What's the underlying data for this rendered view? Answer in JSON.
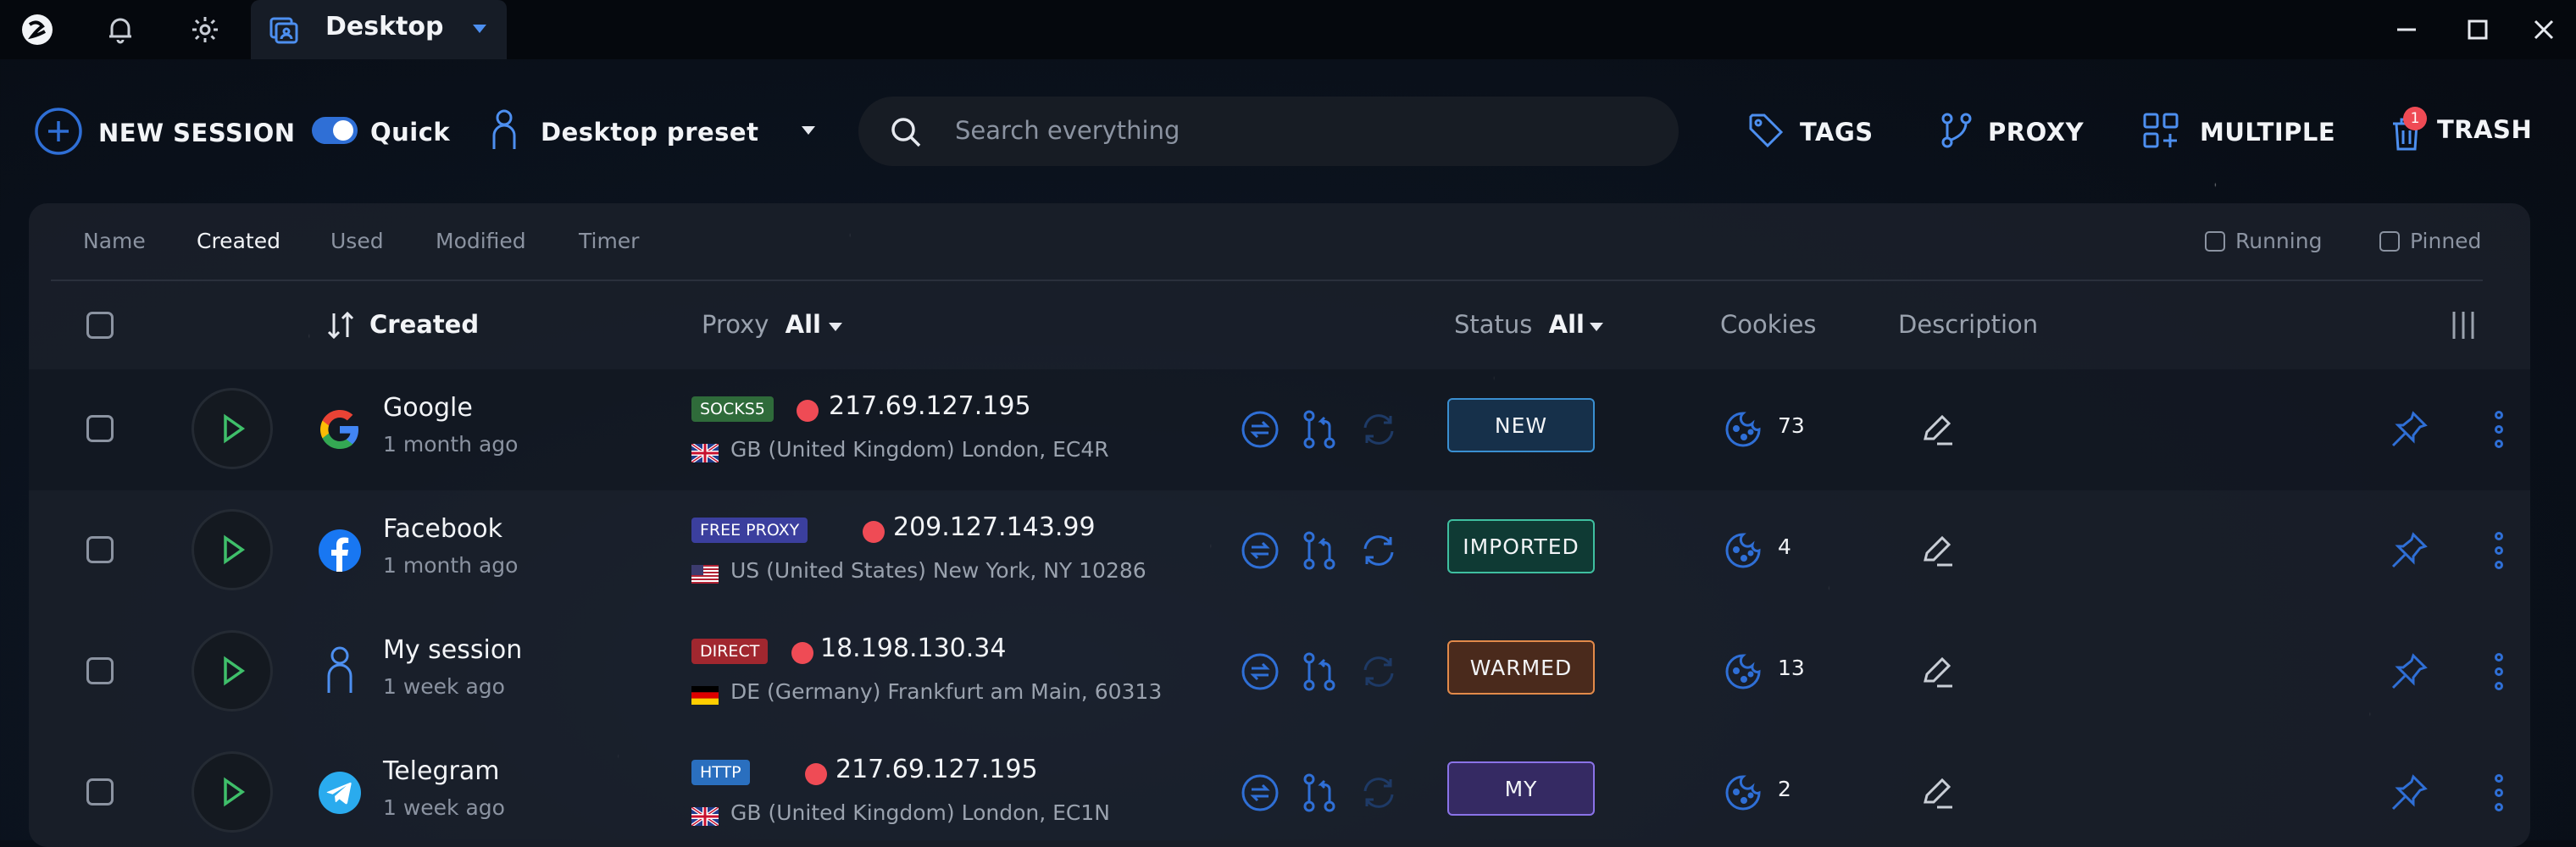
{
  "titlebar": {
    "tab_title": "Desktop"
  },
  "toolbar": {
    "new_session": "NEW SESSION",
    "quick": "Quick",
    "preset": "Desktop preset",
    "tags": "TAGS",
    "proxy": "PROXY",
    "multiple": "MULTIPLE",
    "trash": "TRASH",
    "trash_badge": "1"
  },
  "search": {
    "placeholder": "Search everything"
  },
  "sortbar": {
    "items": [
      "Name",
      "Created",
      "Used",
      "Modified",
      "Timer"
    ],
    "active": "Created",
    "running": "Running",
    "pinned": "Pinned"
  },
  "columns": {
    "created": "Created",
    "proxy": "Proxy",
    "proxy_filter": "All",
    "status": "Status",
    "status_filter": "All",
    "cookies": "Cookies",
    "description": "Description"
  },
  "sessions": [
    {
      "name": "Google",
      "age": "1 month ago",
      "proxy_type": "SOCKS5",
      "ip": "217.69.127.195",
      "location": "GB (United Kingdom) London, EC4R",
      "status": "NEW",
      "cookies": "73"
    },
    {
      "name": "Facebook",
      "age": "1 month ago",
      "proxy_type": "FREE PROXY",
      "ip": "209.127.143.99",
      "location": "US (United States) New York, NY 10286",
      "status": "IMPORTED",
      "cookies": "4"
    },
    {
      "name": "My session",
      "age": "1 week ago",
      "proxy_type": "DIRECT",
      "ip": "18.198.130.34",
      "location": "DE (Germany) Frankfurt am Main, 60313",
      "status": "WARMED",
      "cookies": "13"
    },
    {
      "name": "Telegram",
      "age": "1 week ago",
      "proxy_type": "HTTP",
      "ip": "217.69.127.195",
      "location": "GB (United Kingdom) London, EC1N",
      "status": "MY",
      "cookies": "2"
    }
  ],
  "colors": {
    "accent": "#2f6fd6",
    "socks5": "#2f6b3a",
    "free_proxy": "#3b3f9e",
    "direct": "#a1272f",
    "http": "#2a6fbf",
    "status_new": "#3a8fd1",
    "status_imported": "#3fbfa0",
    "status_warmed": "#e28a4a",
    "status_my": "#8a73e8"
  }
}
